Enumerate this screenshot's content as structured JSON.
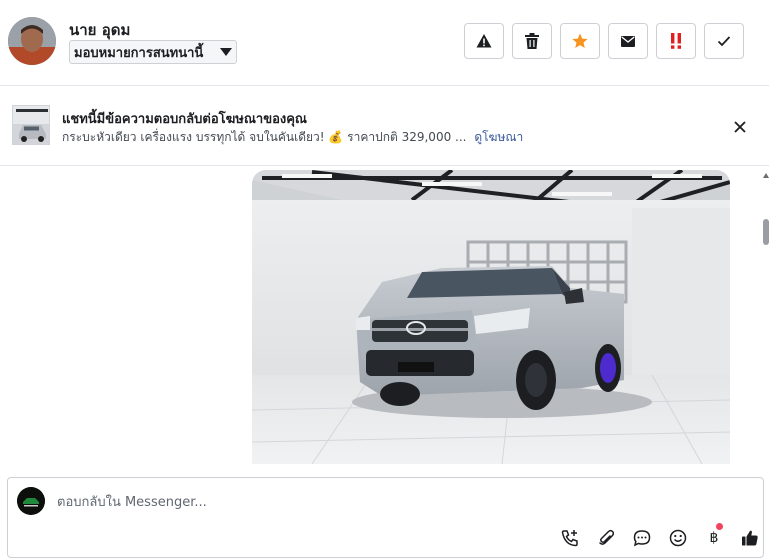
{
  "header": {
    "contact_name": "นาย อุดม",
    "assign_label": "มอบหมายการสนทนานี้",
    "actions": [
      {
        "name": "spam-button",
        "icon": "warning-triangle-icon"
      },
      {
        "name": "delete-button",
        "icon": "trash-icon"
      },
      {
        "name": "star-button",
        "icon": "star-icon"
      },
      {
        "name": "mark-unread-button",
        "icon": "envelope-icon"
      },
      {
        "name": "mark-important-button",
        "icon": "double-exclamation-icon"
      },
      {
        "name": "mark-done-button",
        "icon": "checkmark-icon"
      }
    ]
  },
  "ad_banner": {
    "title": "แชทนี้มีข้อความตอบกลับต่อโฆษณาของคุณ",
    "description": "กระบะหัวเดียว เครื่องแรง บรรทุกได้ จบในคันเดียว! 💰 ราคาปกติ 329,000 ...",
    "link_label": "ดูโฆษณา"
  },
  "composer": {
    "placeholder": "ตอบกลับใน Messenger...",
    "tools": [
      "phone-plus-icon",
      "paperclip-icon",
      "chat-bubble-icon",
      "emoji-icon",
      "baht-icon",
      "thumbs-up-icon"
    ],
    "baht_symbol": "฿"
  },
  "colors": {
    "star": "#f7931e",
    "important": "#e02020",
    "link": "#385898",
    "notification": "#f3425f"
  }
}
